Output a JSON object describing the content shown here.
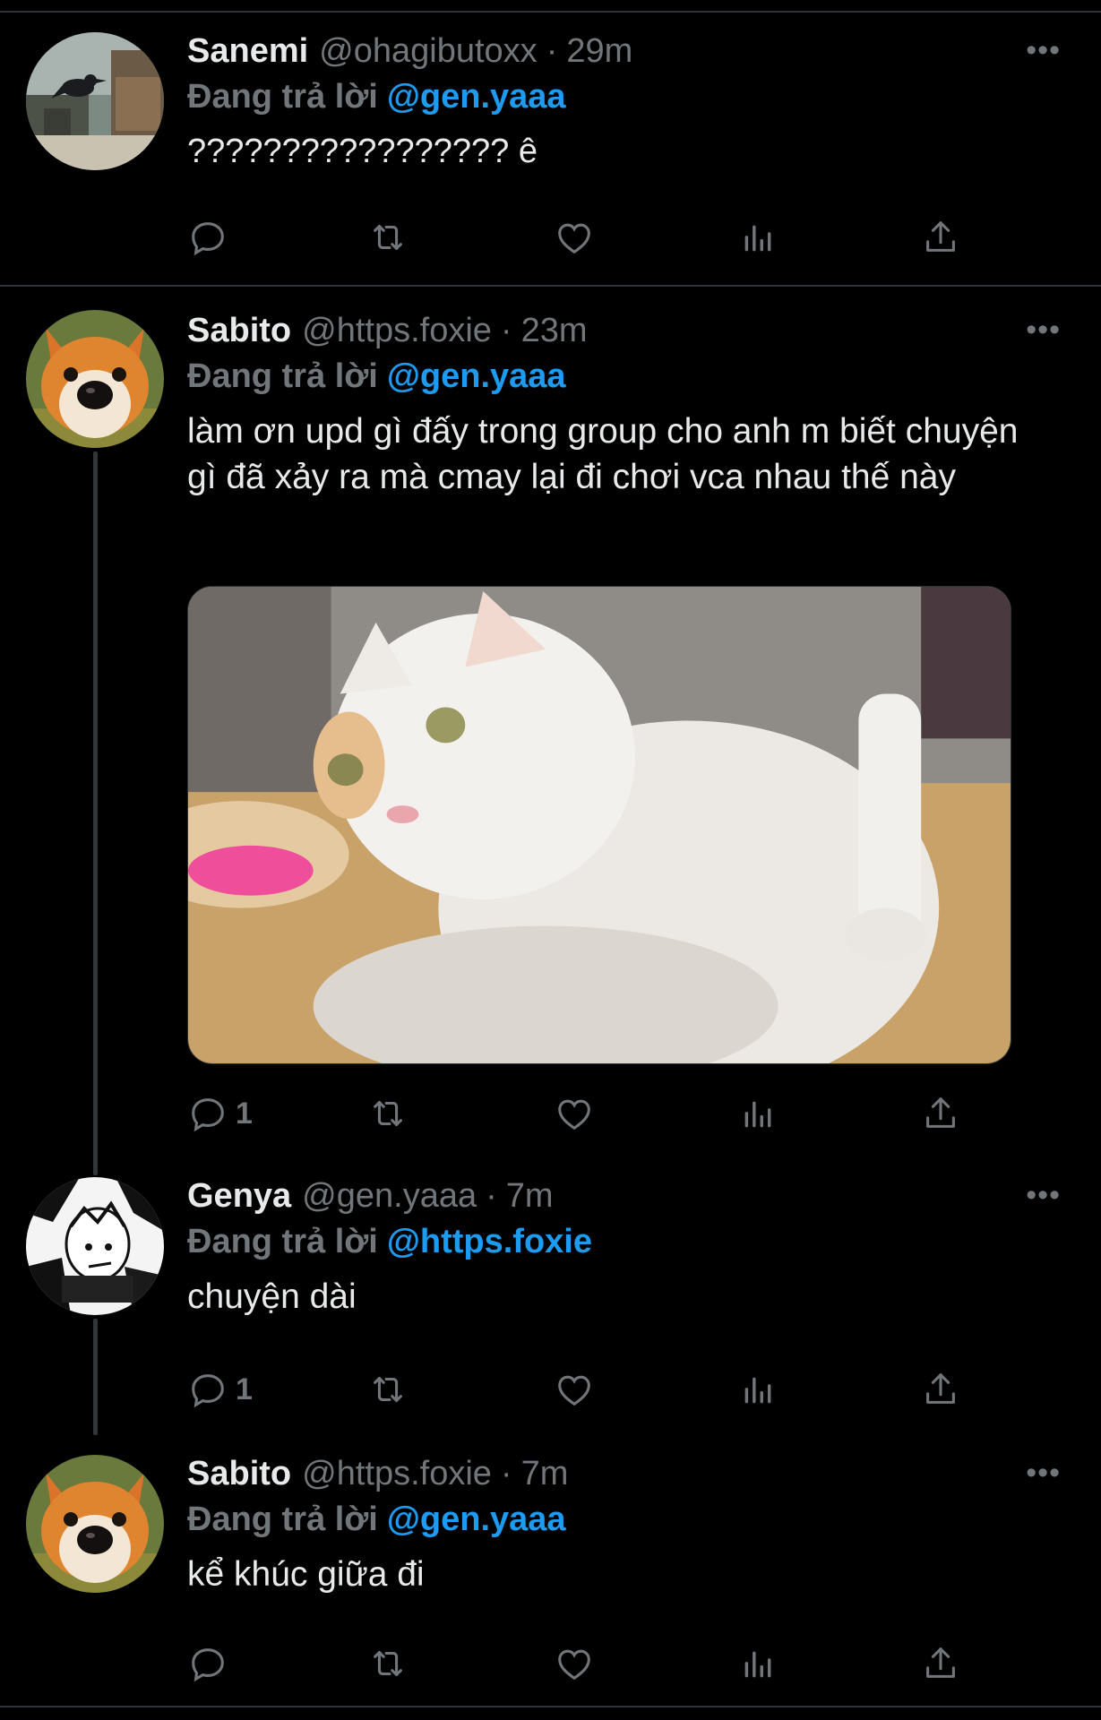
{
  "tweets": [
    {
      "name": "Sanemi",
      "handle": "@ohagibutoxx",
      "dot": "·",
      "time": "29m",
      "replying_prefix": "Đang trả lời",
      "replying_to": "@gen.yaaa",
      "text": "????????????????? ê",
      "reply_count": "",
      "more": "•••"
    },
    {
      "name": "Sabito",
      "handle": "@https.foxie",
      "dot": "·",
      "time": "23m",
      "replying_prefix": "Đang trả lời",
      "replying_to": "@gen.yaaa",
      "text": "làm ơn upd gì đấy trong group cho anh m biết chuyện gì đã xảy ra mà cmay lại đi chơi vca nhau thế này",
      "reply_count": "1",
      "more": "•••"
    },
    {
      "name": "Genya",
      "handle": "@gen.yaaa",
      "dot": "·",
      "time": "7m",
      "replying_prefix": "Đang trả lời",
      "replying_to": "@https.foxie",
      "text": "chuyện dài",
      "reply_count": "1",
      "more": "•••"
    },
    {
      "name": "Sabito",
      "handle": "@https.foxie",
      "dot": "·",
      "time": "7m",
      "replying_prefix": "Đang trả lời",
      "replying_to": "@gen.yaaa",
      "text": "kể khúc giữa đi",
      "reply_count": "",
      "more": "•••"
    }
  ],
  "icons": {
    "reply": "reply-icon",
    "retweet": "retweet-icon",
    "like": "heart-icon",
    "views": "views-icon",
    "share": "share-icon",
    "more": "more-icon"
  },
  "colors": {
    "background": "#000000",
    "text": "#e7e9ea",
    "muted": "#71767b",
    "link": "#1d9bf0",
    "divider": "#2f3336"
  }
}
